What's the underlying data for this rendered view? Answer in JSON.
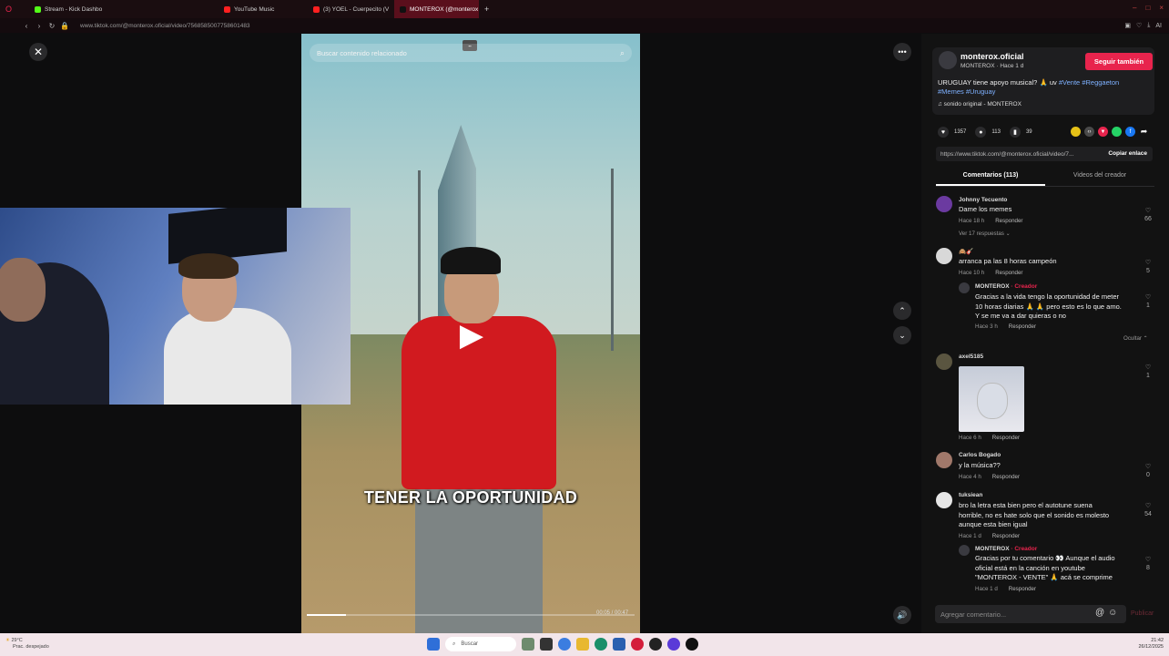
{
  "browser": {
    "tabs": [
      {
        "label": "Stream - Kick Dashbo",
        "color": "#53fc18"
      },
      {
        "label": "YouTube Music",
        "color": "#ff2020"
      },
      {
        "label": "(3) YOEL - Cuerpecito (V",
        "color": "#ff2020"
      },
      {
        "label": "MONTEROX (@monterox",
        "color": "#111111",
        "active": true
      }
    ],
    "url": "www.tiktok.com/@monterox.oficial/video/7568585007758601483"
  },
  "video": {
    "search_placeholder": "Buscar contenido relacionado",
    "caption": "TENER LA OPORTUNIDAD",
    "progress_fraction": 0.12,
    "time": "00:05 / 00:47"
  },
  "author": {
    "name": "monterox.oficial",
    "sub": "MONTEROX · Hace 1 d",
    "follow_label": "Seguir también",
    "desc_text": "URUGUAY tiene apoyo musical? 🙏 uv ",
    "hashtags_line1": "#Vente #Reggaeton",
    "hashtags_line2": "#Memes #Uruguay",
    "sound": "♫  sonido original - MONTEROX"
  },
  "stats": {
    "likes": "1357",
    "comments": "113",
    "saves": "39"
  },
  "share": {
    "colors": [
      "#e6c117",
      "#4a4a4a",
      "#e8244d",
      "#25d366",
      "#1877f2"
    ],
    "link": "https://www.tiktok.com/@monterox.oficial/video/7...",
    "copy_label": "Copiar enlace"
  },
  "comment_tabs": [
    "Comentarios (113)",
    "Videos del creador"
  ],
  "comments": [
    {
      "user": "Johnny Tecuento",
      "text": "Dame los memes",
      "meta": "Hace 18 h",
      "reply": "Responder",
      "likes": "66",
      "replies": "Ver 17 respuestas ⌄"
    },
    {
      "user": "🙈🎸",
      "text": "arranca pa las 8 horas campeón",
      "meta": "Hace 10 h",
      "reply": "Responder",
      "likes": "5"
    },
    {
      "user": "MONTEROX",
      "creator": "· Creador",
      "text_l1": "Gracias a la vida tengo la oportunidad de meter",
      "text_l2": "10 horas diarias 🙏 🙏 pero esto es lo que amo.",
      "text_l3": "Y se me va a dar quieras o no",
      "meta": "Hace 3 h",
      "reply": "Responder",
      "likes": "1",
      "hide": "Ocultar ⌃"
    },
    {
      "user": "axel5185",
      "meta": "Hace 6 h",
      "reply": "Responder",
      "likes": "1"
    },
    {
      "user": "Carlos Bogado",
      "text": "y la música??",
      "meta": "Hace 4 h",
      "reply": "Responder",
      "likes": "0"
    },
    {
      "user": "tuksiean",
      "text_l1": "bro la letra esta bien pero el autotune suena",
      "text_l2": "horrible, no es hate solo que el sonido es molesto",
      "text_l3": "aunque esta bien igual",
      "meta": "Hace 1 d",
      "reply": "Responder",
      "likes": "54"
    },
    {
      "user": "MONTEROX",
      "creator": "· Creador",
      "text_l1": "Gracias por tu comentario 👀 Aunque el audio",
      "text_l2": "oficial está en la canción en youtube",
      "text_l3": "\"MONTEROX - VENTE\" 🙏 acá se comprime",
      "meta": "Hace 1 d",
      "reply": "Responder",
      "likes": "8"
    }
  ],
  "comment_input": {
    "placeholder": "Agregar comentario...",
    "post": "Publicar"
  },
  "taskbar": {
    "weather_temp": "29°C",
    "weather_desc": "Prac. despejado",
    "search": "Buscar",
    "time": "21:42",
    "date": "26/12/2025"
  }
}
